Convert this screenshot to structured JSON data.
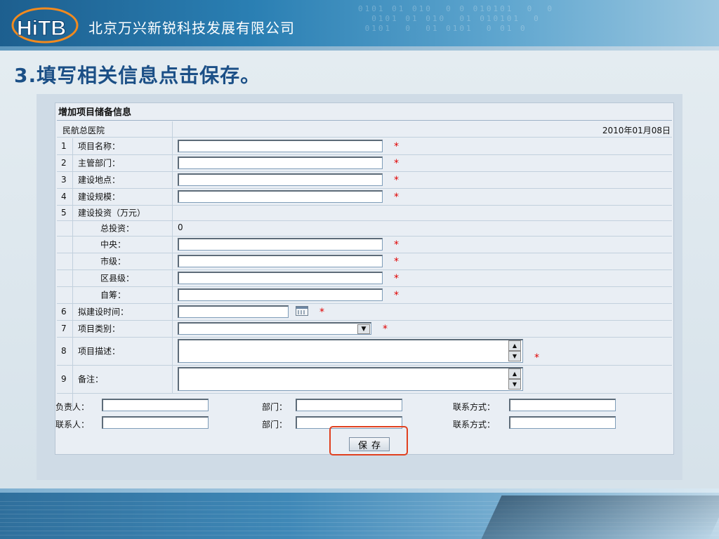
{
  "banner": {
    "company": "北京万兴新锐科技发展有限公司",
    "logo_text": "HiTB",
    "digits": "0101 01 010  0 0 010101  0  0\n  0101 01 010  01 010101  0\n 0101  0  01 0101  0 01 0"
  },
  "slide": {
    "heading": "3.填写相关信息点击保存。"
  },
  "form": {
    "title": "增加项目储备信息",
    "hospital": "民航总医院",
    "date": "2010年01月08日",
    "required_mark": "*",
    "rows": [
      {
        "num": "1",
        "label": "项目名称："
      },
      {
        "num": "2",
        "label": "主管部门："
      },
      {
        "num": "3",
        "label": "建设地点："
      },
      {
        "num": "4",
        "label": "建设规模："
      },
      {
        "num": "5",
        "label": "建设投资（万元）"
      },
      {
        "num": "",
        "label": "总投资：",
        "value": "0"
      },
      {
        "num": "",
        "label": "中央："
      },
      {
        "num": "",
        "label": "市级："
      },
      {
        "num": "",
        "label": "区县级："
      },
      {
        "num": "",
        "label": "自筹："
      },
      {
        "num": "6",
        "label": "拟建设时间："
      },
      {
        "num": "7",
        "label": "项目类别："
      },
      {
        "num": "8",
        "label": "项目描述："
      },
      {
        "num": "9",
        "label": "备注："
      }
    ],
    "contacts": [
      {
        "person_label": "负责人：",
        "dept_label": "部门：",
        "contact_label": "联系方式："
      },
      {
        "person_label": "联系人：",
        "dept_label": "部门：",
        "contact_label": "联系方式："
      }
    ],
    "save_label": "保存"
  },
  "colors": {
    "accent": "#1b4f86",
    "required": "#e00000",
    "highlight": "#e0401f"
  }
}
